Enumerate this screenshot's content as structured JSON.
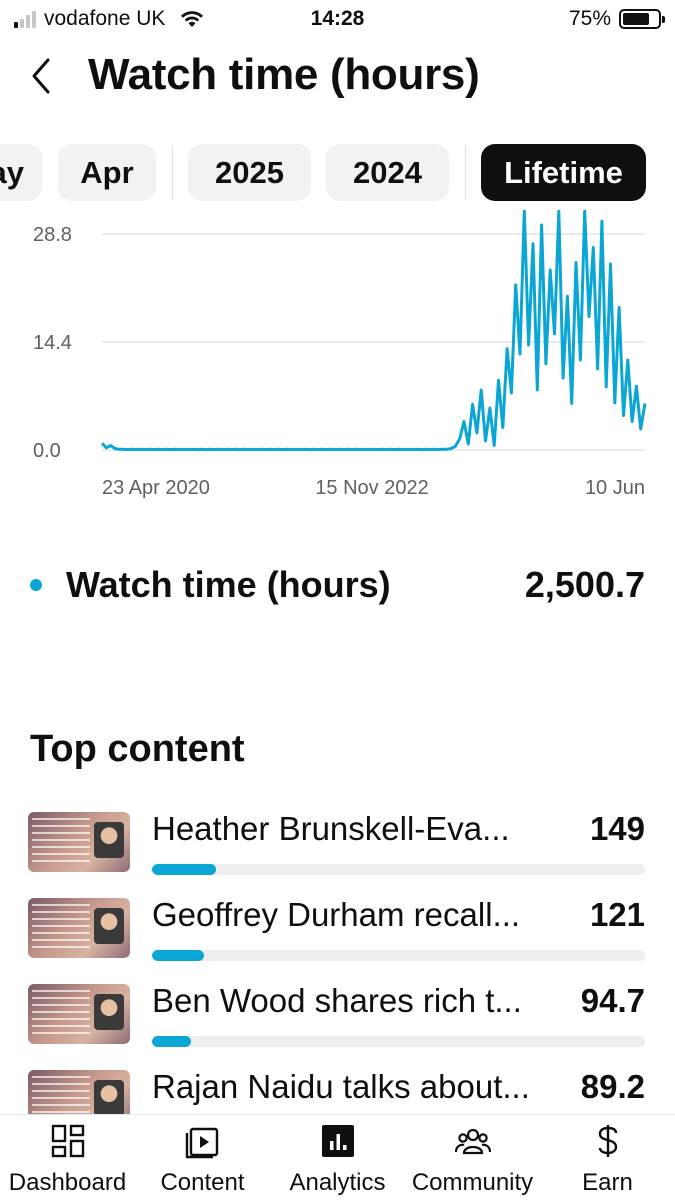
{
  "status_bar": {
    "carrier": "vodafone UK",
    "time": "14:28",
    "battery": "75%",
    "battery_level": 0.75
  },
  "header": {
    "title": "Watch time (hours)"
  },
  "period_chips": [
    {
      "label": "ay",
      "selected": false
    },
    {
      "label": "Apr",
      "selected": false
    },
    {
      "label": "2025",
      "selected": false
    },
    {
      "label": "2024",
      "selected": false
    },
    {
      "label": "Lifetime",
      "selected": true
    }
  ],
  "chart_data": {
    "type": "line",
    "color": "#0ca6d4",
    "yticks": [
      "28.8",
      "14.4",
      "0.0"
    ],
    "ytick_values": [
      28.8,
      14.4,
      0.0
    ],
    "ylim": [
      0,
      32
    ],
    "xticks": [
      "23 Apr 2020",
      "15 Nov 2022",
      "10 Jun"
    ],
    "grid": true,
    "series": [
      {
        "values": [
          0.9,
          0.3,
          0.6,
          0.2,
          0.1,
          0.1,
          0.05,
          0.1,
          0.05,
          0.1,
          0.05,
          0.1,
          0.05,
          0.1,
          0.05,
          0.1,
          0.05,
          0.1,
          0.05,
          0.1,
          0.05,
          0.1,
          0.05,
          0.1,
          0.05,
          0.1,
          0.05,
          0.1,
          0.05,
          0.1,
          0.05,
          0.1,
          0.05,
          0.1,
          0.05,
          0.1,
          0.05,
          0.1,
          0.05,
          0.1,
          0.05,
          0.1,
          0.05,
          0.1,
          0.05,
          0.1,
          0.05,
          0.1,
          0.05,
          0.1,
          0.05,
          0.1,
          0.05,
          0.1,
          0.05,
          0.1,
          0.05,
          0.1,
          0.05,
          0.1,
          0.05,
          0.1,
          0.05,
          0.1,
          0.05,
          0.1,
          0.05,
          0.1,
          0.05,
          0.1,
          0.05,
          0.1,
          0.05,
          0.1,
          0.05,
          0.1,
          0.05,
          0.1,
          0.05,
          0.1,
          0.1,
          0.2,
          0.5,
          1.5,
          3.8,
          0.8,
          6.1,
          2.3,
          8.0,
          1.2,
          5.6,
          0.6,
          9.3,
          3.0,
          13.5,
          7.6,
          22.0,
          12.8,
          34.0,
          14.0,
          27.5,
          8.0,
          30.0,
          11.5,
          24.0,
          15.5,
          33.6,
          9.6,
          20.5,
          6.2,
          25.0,
          12.0,
          34.0,
          17.8,
          27.0,
          10.8,
          30.5,
          8.4,
          24.8,
          6.3,
          19.0,
          4.6,
          12.0,
          3.8,
          8.5,
          2.8,
          6.2
        ]
      }
    ]
  },
  "metric": {
    "label": "Watch time (hours)",
    "value": "2,500.7"
  },
  "top_content": {
    "title": "Top content",
    "items": [
      {
        "name": "Heather Brunskell-Eva...",
        "value": "149",
        "fraction": 0.13
      },
      {
        "name": "Geoffrey Durham recall...",
        "value": "121",
        "fraction": 0.105
      },
      {
        "name": "Ben Wood shares rich t...",
        "value": "94.7",
        "fraction": 0.08
      },
      {
        "name": "Rajan Naidu talks about...",
        "value": "89.2",
        "fraction": 0.075
      }
    ]
  },
  "bottom_nav": [
    {
      "label": "Dashboard",
      "icon": "dashboard-icon",
      "active": false
    },
    {
      "label": "Content",
      "icon": "content-icon",
      "active": false
    },
    {
      "label": "Analytics",
      "icon": "analytics-icon",
      "active": true
    },
    {
      "label": "Community",
      "icon": "community-icon",
      "active": false
    },
    {
      "label": "Earn",
      "icon": "dollar-icon",
      "active": false
    }
  ]
}
